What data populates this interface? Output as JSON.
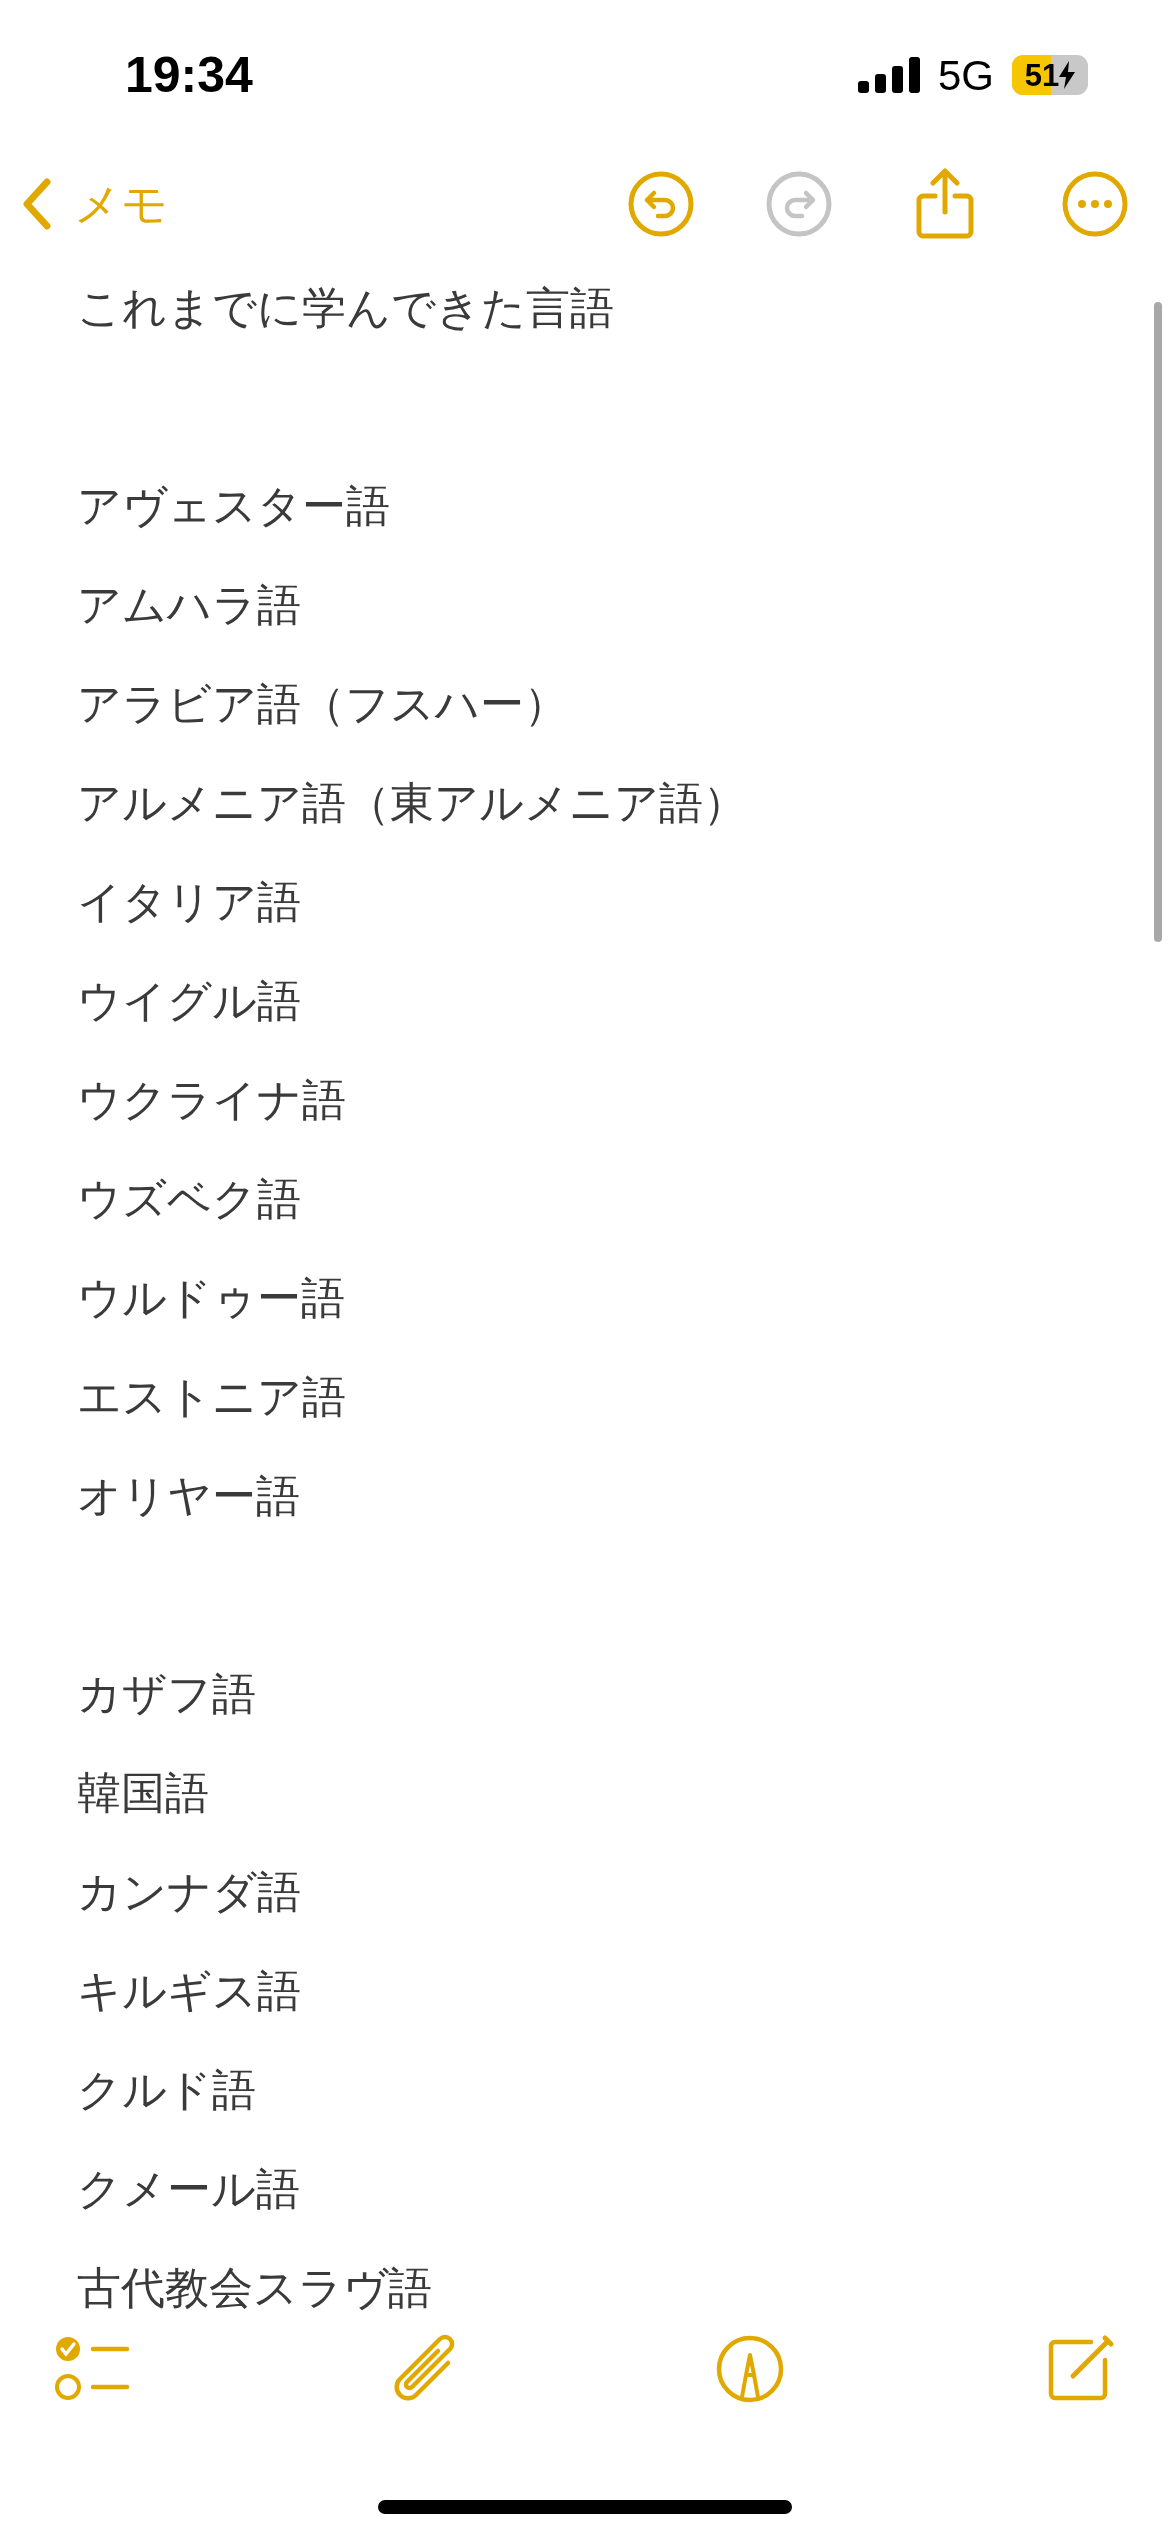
{
  "status_bar": {
    "time": "19:34",
    "network": "5G",
    "battery": {
      "text": "51",
      "level": 0.51,
      "charging": true
    }
  },
  "nav": {
    "back_label": "メモ",
    "undo_disabled": false,
    "redo_disabled": true
  },
  "note": {
    "title": "これまでに学んできた言語",
    "groups": [
      [
        "アヴェスター語",
        "アムハラ語",
        "アラビア語（フスハー）",
        "アルメニア語（東アルメニア語）",
        "イタリア語",
        "ウイグル語",
        "ウクライナ語",
        "ウズベク語",
        "ウルドゥー語",
        "エストニア語",
        "オリヤー語"
      ],
      [
        "カザフ語",
        "韓国語",
        "カンナダ語",
        "キルギス語",
        "クルド語",
        "クメール語",
        "古代教会スラヴ語"
      ]
    ]
  }
}
